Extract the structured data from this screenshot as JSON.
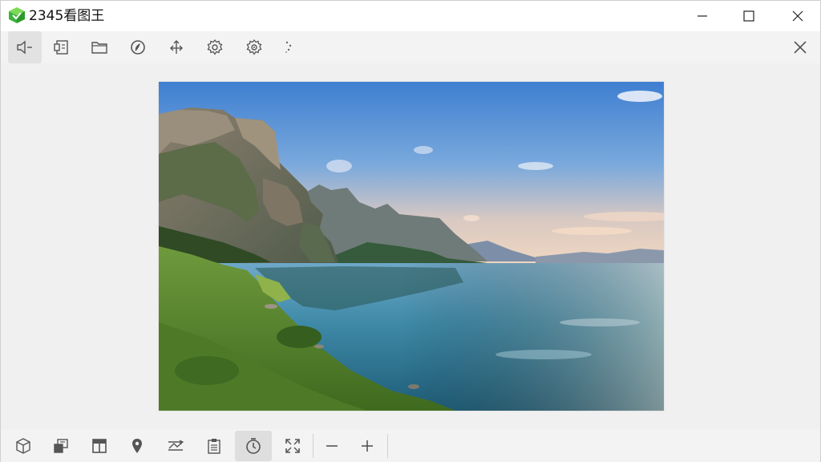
{
  "window": {
    "title": "2345看图王"
  },
  "title_bar": {
    "logo_icon": "green-cube-logo-icon",
    "controls": [
      "minimize-icon",
      "maximize-icon",
      "close-icon"
    ]
  },
  "top_toolbar": {
    "items": [
      {
        "icon": "volume-mute-icon",
        "active": true
      },
      {
        "icon": "slideshow-icon",
        "active": false
      },
      {
        "icon": "open-folder-icon",
        "active": false
      },
      {
        "icon": "browser-icon",
        "active": false
      },
      {
        "icon": "share-icon",
        "active": false
      },
      {
        "icon": "settings-icon",
        "active": false
      },
      {
        "icon": "advanced-settings-icon",
        "active": false
      },
      {
        "icon": "loading-spinner-icon",
        "active": false
      }
    ],
    "close_icon": "close-panel-icon"
  },
  "viewer": {
    "image_content": "mountain-lake-landscape"
  },
  "bottom_toolbar": {
    "items": [
      {
        "icon": "3d-box-icon",
        "active": false
      },
      {
        "icon": "copy-layers-icon",
        "active": false
      },
      {
        "icon": "layout-icon",
        "active": false
      },
      {
        "icon": "location-pin-icon",
        "active": false
      },
      {
        "icon": "crop-transform-icon",
        "active": false
      },
      {
        "icon": "clipboard-icon",
        "active": false
      },
      {
        "icon": "clock-icon",
        "active": true
      },
      {
        "icon": "fullscreen-icon",
        "active": false
      },
      {
        "icon": "zoom-out-icon",
        "active": false
      },
      {
        "icon": "zoom-in-icon",
        "active": false
      }
    ]
  },
  "colors": {
    "toolbar_bg": "#f3f3f3",
    "titlebar_bg": "#ffffff",
    "canvas_bg": "#f0f0f0",
    "icon_color": "#555555",
    "logo_green": "#3db33d"
  }
}
